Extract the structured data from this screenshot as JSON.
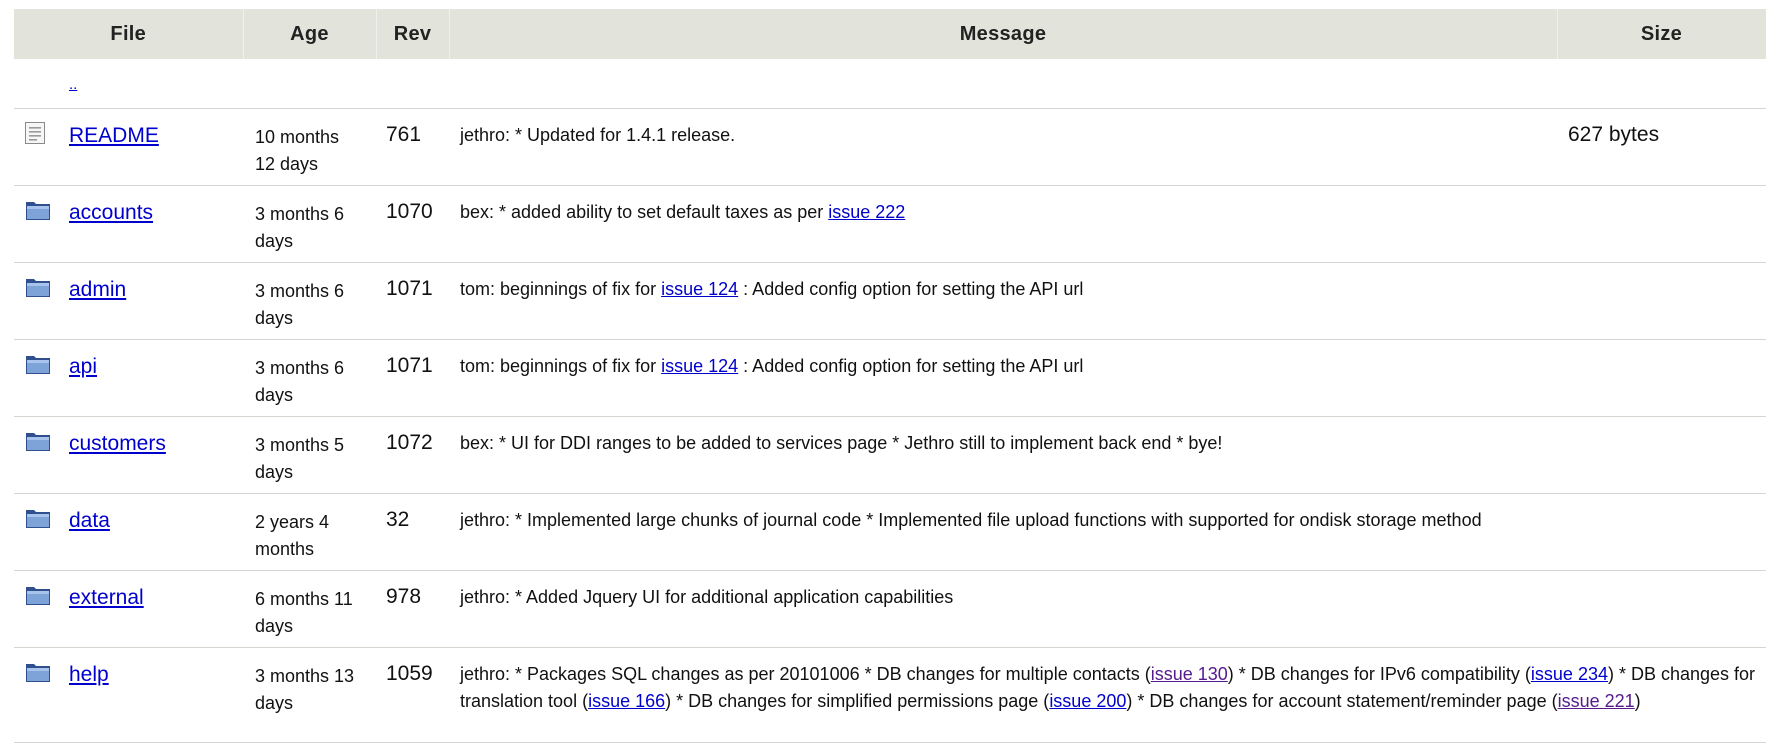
{
  "table": {
    "headers": {
      "file": "File",
      "age": "Age",
      "rev": "Rev",
      "message": "Message",
      "size": "Size"
    },
    "parent_link": "..",
    "rows": [
      {
        "icon": "file-icon",
        "name": "README",
        "age_line1": "10 months",
        "age_line2": "12 days",
        "rev": "761",
        "msg": {
          "t0": "jethro: * Updated for 1.4.1 release."
        },
        "size": "627 bytes"
      },
      {
        "icon": "folder-icon",
        "name": "accounts",
        "age_line1": "3 months 6",
        "age_line2": "days",
        "rev": "1070",
        "msg": {
          "t0": "bex: * added ability to set default taxes as per ",
          "l1": "issue 222"
        },
        "size": ""
      },
      {
        "icon": "folder-icon",
        "name": "admin",
        "age_line1": "3 months 6",
        "age_line2": "days",
        "rev": "1071",
        "msg": {
          "t0": "tom: beginnings of fix for ",
          "l1": "issue 124",
          "t1": " : Added config option for setting the API url"
        },
        "size": ""
      },
      {
        "icon": "folder-icon",
        "name": "api",
        "age_line1": "3 months 6",
        "age_line2": "days",
        "rev": "1071",
        "msg": {
          "t0": "tom: beginnings of fix for ",
          "l1": "issue 124",
          "t1": " : Added config option for setting the API url"
        },
        "size": ""
      },
      {
        "icon": "folder-icon",
        "name": "customers",
        "age_line1": "3 months 5",
        "age_line2": "days",
        "rev": "1072",
        "msg": {
          "t0": "bex: * UI for DDI ranges to be added to services page * Jethro still to implement back end * bye!"
        },
        "size": ""
      },
      {
        "icon": "folder-icon",
        "name": "data",
        "age_line1": "2 years 4",
        "age_line2": "months",
        "rev": "32",
        "msg": {
          "t0": "jethro: * Implemented large chunks of journal code * Implemented file upload functions with supported for ondisk storage method"
        },
        "size": ""
      },
      {
        "icon": "folder-icon",
        "name": "external",
        "age_line1": "6 months 11",
        "age_line2": "days",
        "rev": "978",
        "msg": {
          "t0": "jethro: * Added Jquery UI for additional application capabilities"
        },
        "size": ""
      },
      {
        "icon": "folder-icon",
        "name": "help",
        "age_line1": "3 months 13",
        "age_line2": "days",
        "rev": "1059",
        "msg": {
          "t0": "jethro: * Packages SQL changes as per 20101006 * DB changes for multiple contacts (",
          "l1": "issue 130",
          "t1": ") * DB changes for IPv6 compatibility (",
          "l2": "issue 234",
          "t2": ") * DB changes for translation tool (",
          "l3": "issue 166",
          "t3": ") * DB changes for simplified permissions page (",
          "l4": "issue 200",
          "t4": ") * DB changes for account statement/reminder page (",
          "l5": "issue 221",
          "t5": ")"
        },
        "size": ""
      }
    ]
  },
  "colors": {
    "header_bg": "#e2e4dc",
    "link": "#0000cc",
    "visited_link": "#551a8b",
    "row_border": "#d4d6cf"
  }
}
